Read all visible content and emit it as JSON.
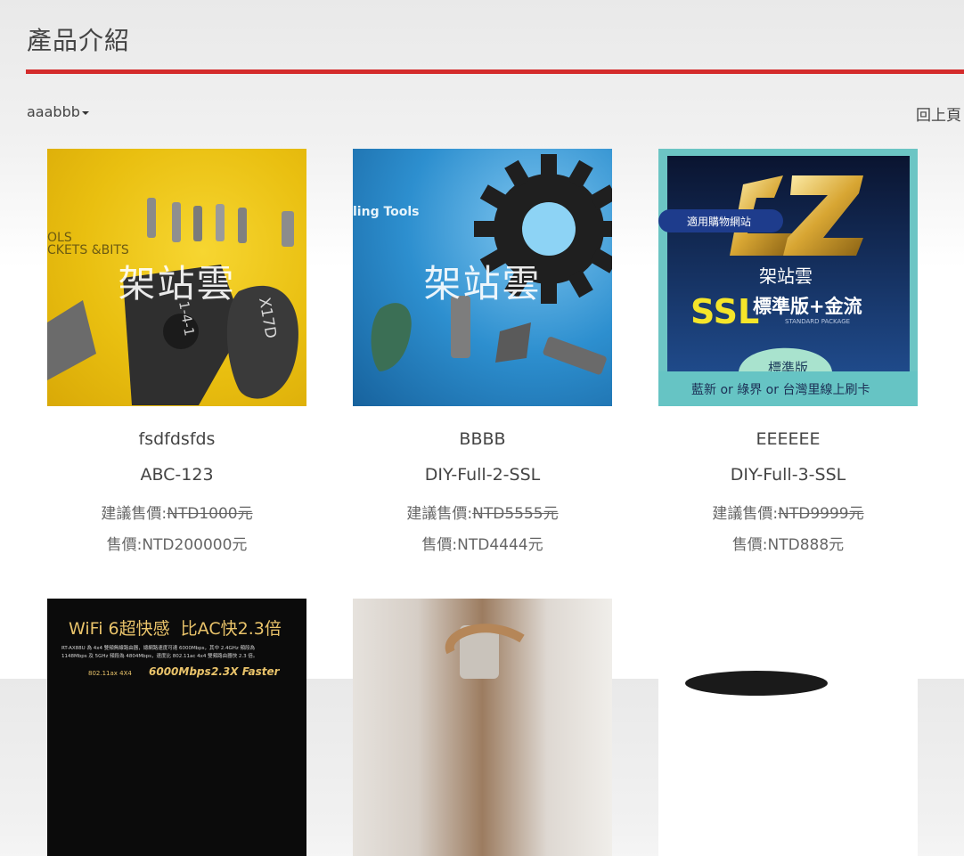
{
  "page": {
    "title": "產品介紹",
    "back_label": "回上頁"
  },
  "filter": {
    "category": "aaabbb"
  },
  "colors": {
    "accent": "#d42b2b"
  },
  "products": [
    {
      "name": "fsdfdsfds",
      "code": "ABC-123",
      "msrp_label": "建議售價:",
      "msrp_value": "NTD1000元",
      "price_label": "售價:",
      "price_value": "NTD200000元",
      "image_text": "架站雲",
      "image_tags": [
        "OLS",
        "CKETS &BITS",
        "1-4-1",
        "X17D"
      ]
    },
    {
      "name": "BBBB",
      "code": "DIY-Full-2-SSL",
      "msrp_label": "建議售價:",
      "msrp_value": "NTD5555元",
      "price_label": "售價:",
      "price_value": "NTD4444元",
      "image_text": "架站雲",
      "image_tags": [
        "ling Tools"
      ]
    },
    {
      "name": "EEEEEE",
      "code": "DIY-Full-3-SSL",
      "msrp_label": "建議售價:",
      "msrp_value": "NTD9999元",
      "price_label": "售價:",
      "price_value": "NTD888元",
      "image_badge": "適用購物網站",
      "image_brand": "架站雲",
      "image_ssl": "SSL",
      "image_plan": "標準版+金流",
      "image_sub": "STANDARD PACKAGE",
      "image_edition": "標準版",
      "image_footer": "藍新 or 綠界 or 台灣里線上刷卡"
    },
    {
      "image_heading": "WiFi 6超快感  比AC快2.3倍",
      "image_line1": "RT-AX88U 為 4x4 雙頻無線路由器，總網路速度可達 6000Mbps，其中 2.4GHz 頻段為",
      "image_line2": "1148Mbps 及 5GHz 頻段為 4804Mbps，速度比 802.11ac 4x4 雙頻路由器快 2.3 倍。",
      "image_spec": "802.11ax 4X4",
      "image_speed": "6000Mbps",
      "image_faster": "2.3X Faster"
    },
    {}
  ]
}
